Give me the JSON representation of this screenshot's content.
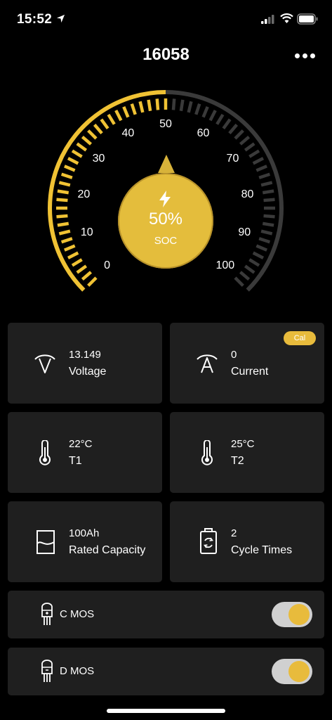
{
  "status_bar": {
    "time": "15:52"
  },
  "header": {
    "title": "16058",
    "more_icon": "more-horizontal-icon"
  },
  "gauge": {
    "soc_percent": 50,
    "tick_labels": [
      "0",
      "10",
      "20",
      "30",
      "40",
      "50",
      "60",
      "70",
      "80",
      "90",
      "100"
    ],
    "active_color": "#f0c234",
    "inactive_color": "#3a3a3a",
    "value_text": "50%",
    "label": "SOC"
  },
  "cards": {
    "voltage": {
      "value": "13.149",
      "label": "Voltage",
      "icon": "voltage-icon"
    },
    "current": {
      "value": "0",
      "label": "Current",
      "icon": "current-icon",
      "badge": "Cal"
    },
    "t1": {
      "value": "22°C",
      "label": "T1",
      "icon": "thermometer-icon"
    },
    "t2": {
      "value": "25°C",
      "label": "T2",
      "icon": "thermometer-icon"
    },
    "capacity": {
      "value": "100Ah",
      "label": "Rated Capacity",
      "icon": "capacity-icon"
    },
    "cycles": {
      "value": "2",
      "label": "Cycle Times",
      "icon": "battery-cycle-icon"
    }
  },
  "mos": {
    "charge": {
      "label": "C MOS",
      "enabled": true,
      "icon": "mosfet-icon"
    },
    "discharge": {
      "label": "D MOS",
      "enabled": true,
      "icon": "mosfet-icon"
    }
  },
  "colors": {
    "accent": "#e8bb3c",
    "card_bg": "#1f1f1f",
    "background": "#000000"
  }
}
